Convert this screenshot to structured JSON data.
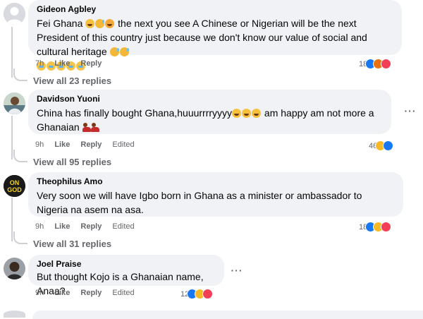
{
  "comments": [
    {
      "author": "Gideon Agbley",
      "text_parts": [
        "Fei Ghana",
        " the next you see A Chinese or Nigerian will be the next President of this country just because we don't know our value of social and cultural heritage"
      ],
      "time": "7h",
      "like": "Like",
      "reply": "Reply",
      "edited": "",
      "reaction_count": "18",
      "reactions": [
        "like-icon",
        "angry-icon",
        "love-icon"
      ],
      "view_all": "View all 23 replies"
    },
    {
      "author": "Davidson Yuoni",
      "text_parts": [
        "China has finally bought Ghana,huuurrrryyyy",
        " am happy am not more a Ghanaian"
      ],
      "time": "9h",
      "like": "Like",
      "reply": "Reply",
      "edited": "Edited",
      "reaction_count": "46",
      "reactions": [
        "haha-icon",
        "like-icon"
      ],
      "view_all": "View all 95 replies"
    },
    {
      "author": "Theophilus Amo",
      "avatar_text": "ON GOD",
      "text_parts": [
        "Very soon we will have Igbo born in Ghana as a minister or ambassador to Nigeria na asem na asa."
      ],
      "time": "9h",
      "like": "Like",
      "reply": "Reply",
      "edited": "Edited",
      "reaction_count": "18",
      "reactions": [
        "like-icon",
        "haha-icon",
        "love-icon"
      ],
      "view_all": "View all 31 replies"
    },
    {
      "author": "Joel Praise",
      "text_parts": [
        "But thought Kojo is a Ghanaian name, Anaa?"
      ],
      "time": "9h",
      "like": "Like",
      "reply": "Reply",
      "edited": "Edited",
      "reaction_count": "12",
      "reactions": [
        "like-icon",
        "haha-icon",
        "love-icon"
      ],
      "view_all": ""
    }
  ],
  "more_label": "···"
}
